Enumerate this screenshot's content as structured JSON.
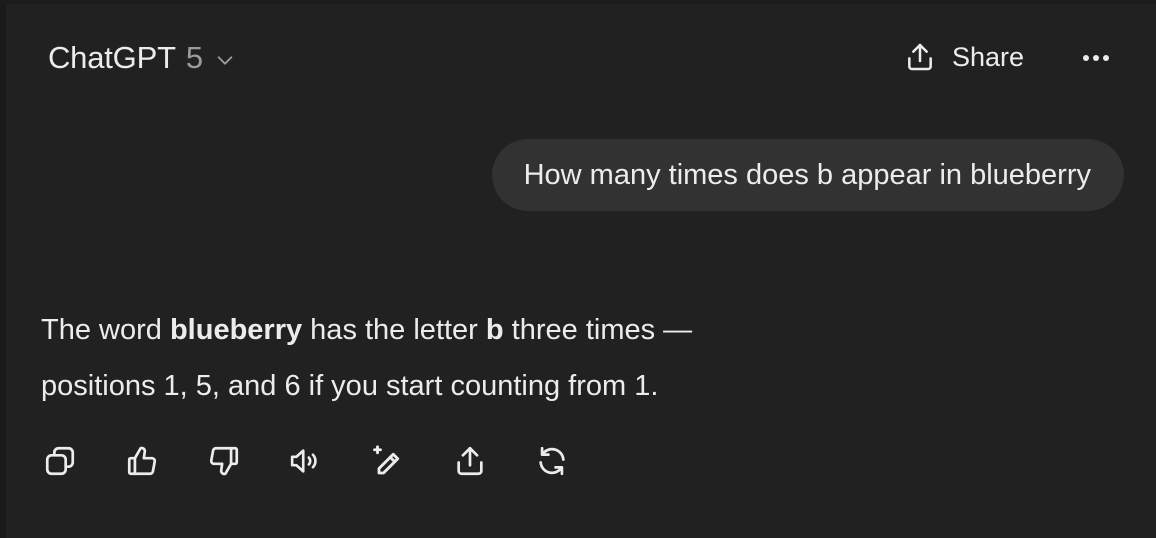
{
  "header": {
    "model_name": "ChatGPT",
    "model_version": "5",
    "share_label": "Share"
  },
  "conversation": {
    "user_message": "How many times does b appear in blueberry",
    "assistant": {
      "line1": {
        "p1": "The word ",
        "b1": "blueberry",
        "p2": " has the letter ",
        "b2": "b",
        "p3": " three times —"
      },
      "line2": "positions 1, 5, and 6 if you start counting from 1."
    }
  },
  "actions": [
    {
      "icon": "copy-icon"
    },
    {
      "icon": "thumbs-up-icon"
    },
    {
      "icon": "thumbs-down-icon"
    },
    {
      "icon": "read-aloud-icon"
    },
    {
      "icon": "edit-canvas-icon"
    },
    {
      "icon": "share-icon"
    },
    {
      "icon": "regenerate-icon"
    }
  ],
  "colors": {
    "background": "#212121",
    "bubble": "#323232",
    "text": "#ececec",
    "muted": "#9b9b9b"
  }
}
